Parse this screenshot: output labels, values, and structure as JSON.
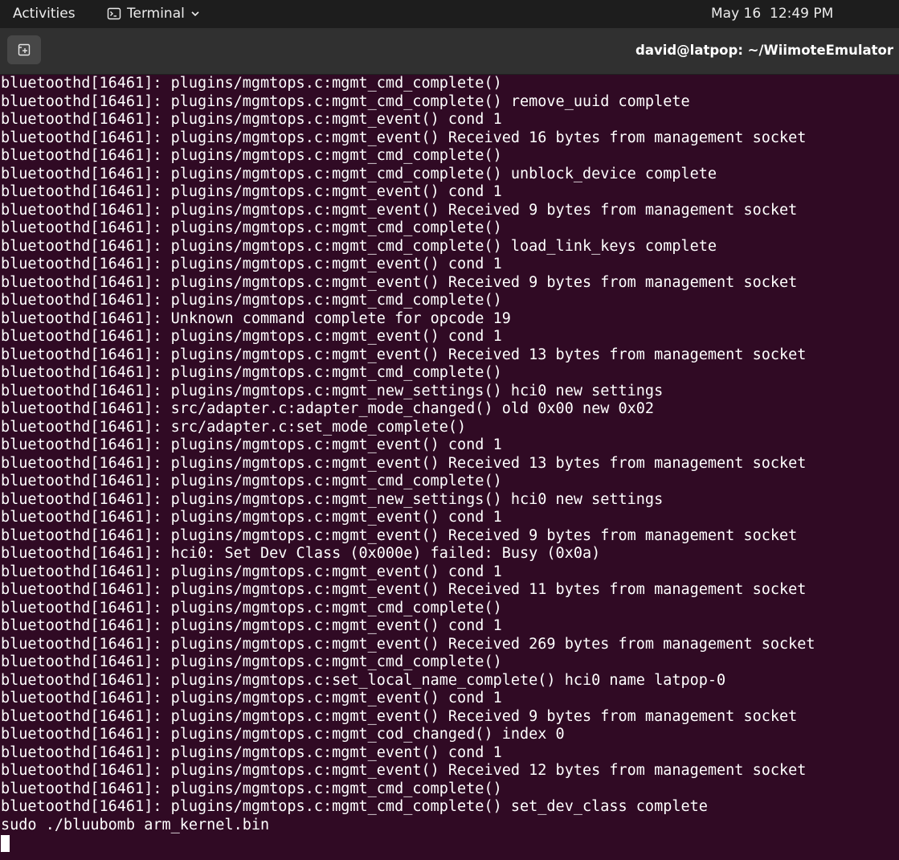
{
  "topbar": {
    "activities_label": "Activities",
    "app_name": "Terminal",
    "date": "May 16",
    "time": "12:49 PM"
  },
  "icons": {
    "terminal": "terminal-icon",
    "app_menu_chevron": "chevron-down-icon",
    "new_tab": "new-tab-icon"
  },
  "colors": {
    "terminal_bg": "#300a24",
    "terminal_fg": "#ffffff",
    "topbar_bg": "#1d1d1d",
    "headerbar_bg": "#303030"
  },
  "window": {
    "title": "david@latpop: ~/WiimoteEmulator"
  },
  "terminal": {
    "lines": [
      "bluetoothd[16461]: plugins/mgmtops.c:mgmt_cmd_complete()",
      "bluetoothd[16461]: plugins/mgmtops.c:mgmt_cmd_complete() remove_uuid complete",
      "bluetoothd[16461]: plugins/mgmtops.c:mgmt_event() cond 1",
      "bluetoothd[16461]: plugins/mgmtops.c:mgmt_event() Received 16 bytes from management socket",
      "bluetoothd[16461]: plugins/mgmtops.c:mgmt_cmd_complete()",
      "bluetoothd[16461]: plugins/mgmtops.c:mgmt_cmd_complete() unblock_device complete",
      "bluetoothd[16461]: plugins/mgmtops.c:mgmt_event() cond 1",
      "bluetoothd[16461]: plugins/mgmtops.c:mgmt_event() Received 9 bytes from management socket",
      "bluetoothd[16461]: plugins/mgmtops.c:mgmt_cmd_complete()",
      "bluetoothd[16461]: plugins/mgmtops.c:mgmt_cmd_complete() load_link_keys complete",
      "bluetoothd[16461]: plugins/mgmtops.c:mgmt_event() cond 1",
      "bluetoothd[16461]: plugins/mgmtops.c:mgmt_event() Received 9 bytes from management socket",
      "bluetoothd[16461]: plugins/mgmtops.c:mgmt_cmd_complete()",
      "bluetoothd[16461]: Unknown command complete for opcode 19",
      "bluetoothd[16461]: plugins/mgmtops.c:mgmt_event() cond 1",
      "bluetoothd[16461]: plugins/mgmtops.c:mgmt_event() Received 13 bytes from management socket",
      "bluetoothd[16461]: plugins/mgmtops.c:mgmt_cmd_complete()",
      "bluetoothd[16461]: plugins/mgmtops.c:mgmt_new_settings() hci0 new settings",
      "bluetoothd[16461]: src/adapter.c:adapter_mode_changed() old 0x00 new 0x02",
      "bluetoothd[16461]: src/adapter.c:set_mode_complete()",
      "bluetoothd[16461]: plugins/mgmtops.c:mgmt_event() cond 1",
      "bluetoothd[16461]: plugins/mgmtops.c:mgmt_event() Received 13 bytes from management socket",
      "bluetoothd[16461]: plugins/mgmtops.c:mgmt_cmd_complete()",
      "bluetoothd[16461]: plugins/mgmtops.c:mgmt_new_settings() hci0 new settings",
      "bluetoothd[16461]: plugins/mgmtops.c:mgmt_event() cond 1",
      "bluetoothd[16461]: plugins/mgmtops.c:mgmt_event() Received 9 bytes from management socket",
      "bluetoothd[16461]: hci0: Set Dev Class (0x000e) failed: Busy (0x0a)",
      "bluetoothd[16461]: plugins/mgmtops.c:mgmt_event() cond 1",
      "bluetoothd[16461]: plugins/mgmtops.c:mgmt_event() Received 11 bytes from management socket",
      "bluetoothd[16461]: plugins/mgmtops.c:mgmt_cmd_complete()",
      "bluetoothd[16461]: plugins/mgmtops.c:mgmt_event() cond 1",
      "bluetoothd[16461]: plugins/mgmtops.c:mgmt_event() Received 269 bytes from management socket",
      "bluetoothd[16461]: plugins/mgmtops.c:mgmt_cmd_complete()",
      "bluetoothd[16461]: plugins/mgmtops.c:set_local_name_complete() hci0 name latpop-0",
      "bluetoothd[16461]: plugins/mgmtops.c:mgmt_event() cond 1",
      "bluetoothd[16461]: plugins/mgmtops.c:mgmt_event() Received 9 bytes from management socket",
      "bluetoothd[16461]: plugins/mgmtops.c:mgmt_cod_changed() index 0",
      "bluetoothd[16461]: plugins/mgmtops.c:mgmt_event() cond 1",
      "bluetoothd[16461]: plugins/mgmtops.c:mgmt_event() Received 12 bytes from management socket",
      "bluetoothd[16461]: plugins/mgmtops.c:mgmt_cmd_complete()",
      "bluetoothd[16461]: plugins/mgmtops.c:mgmt_cmd_complete() set_dev_class complete",
      "sudo ./bluubomb arm_kernel.bin"
    ]
  }
}
